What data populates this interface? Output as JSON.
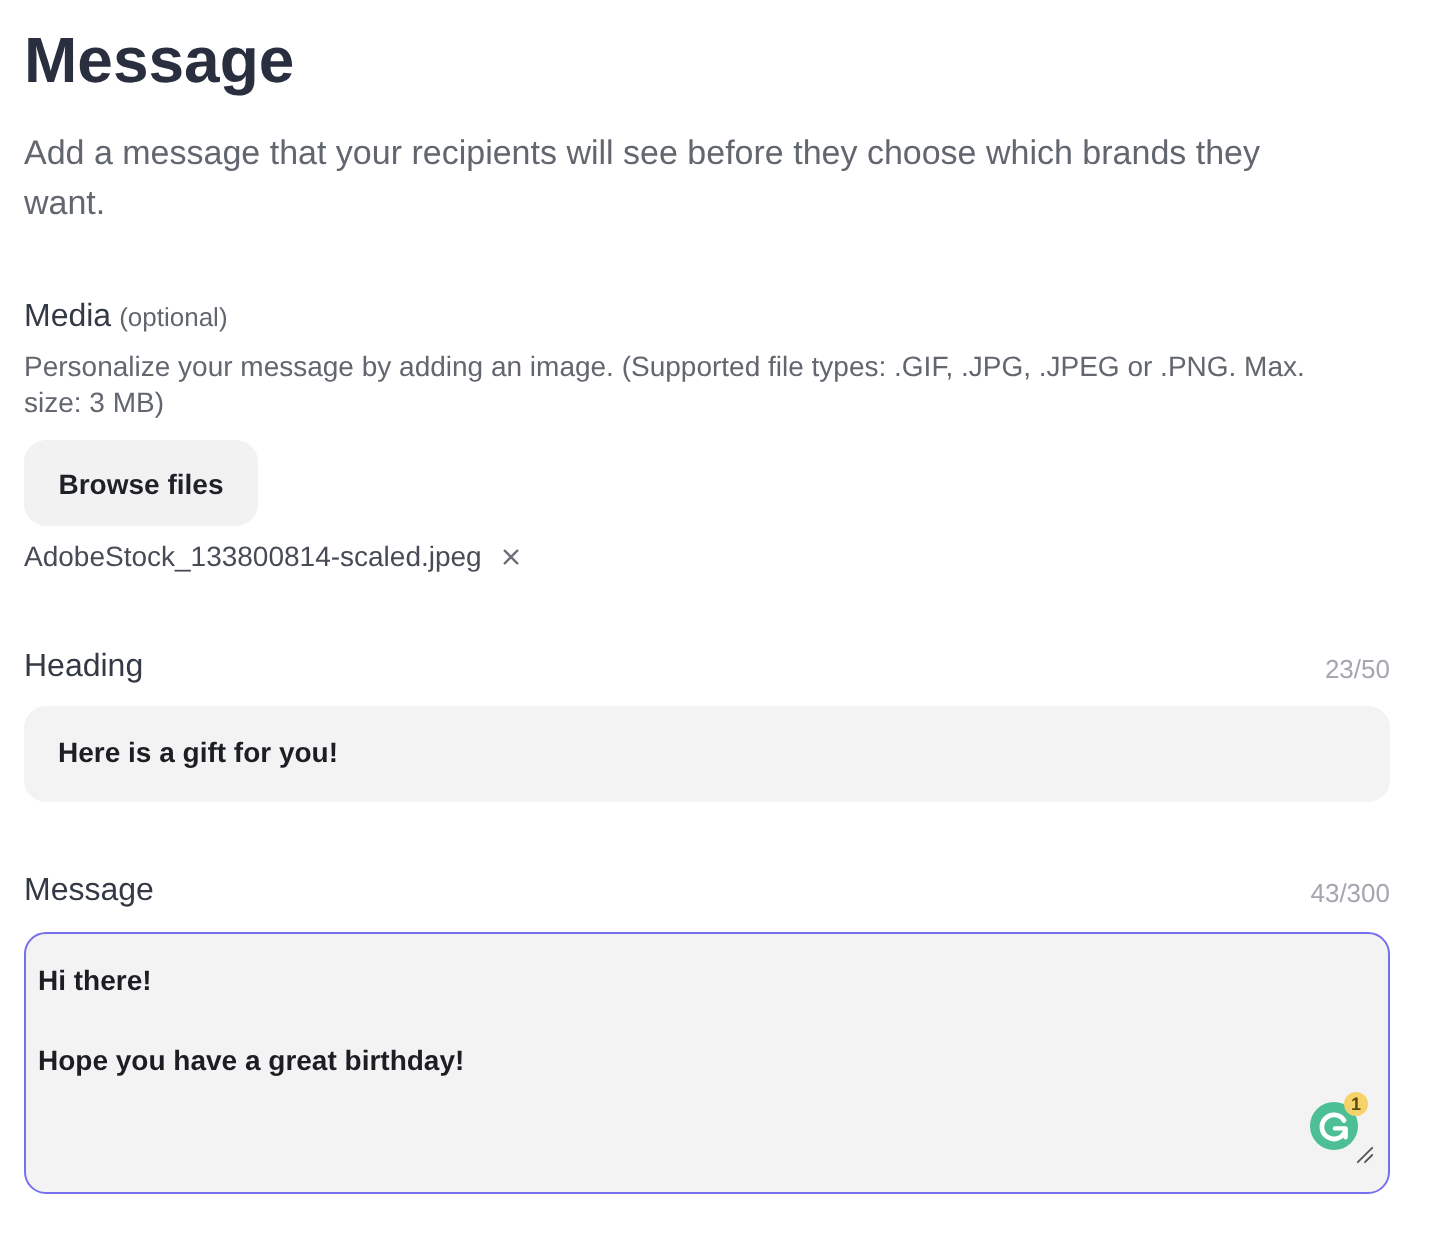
{
  "page": {
    "title": "Message",
    "description": "Add a message that your recipients will see before they choose which brands they want."
  },
  "media": {
    "label": "Media",
    "optional_note": "(optional)",
    "help": "Personalize your message by adding an image. (Supported file types: .GIF, .JPG, .JPEG or .PNG. Max. size: 3 MB)",
    "browse_button": "Browse files",
    "attached_file": "AdobeStock_133800814-scaled.jpeg"
  },
  "fields": [
    {
      "kind": "input",
      "label": "Heading",
      "counter": "23/50",
      "value": "Here is a gift for you!",
      "focused": false
    },
    {
      "kind": "textarea",
      "label": "Message",
      "counter": "43/300",
      "value": "Hi there!\n\nHope you have a great birthday!",
      "focused": true,
      "assistant_badge": "1"
    }
  ]
}
